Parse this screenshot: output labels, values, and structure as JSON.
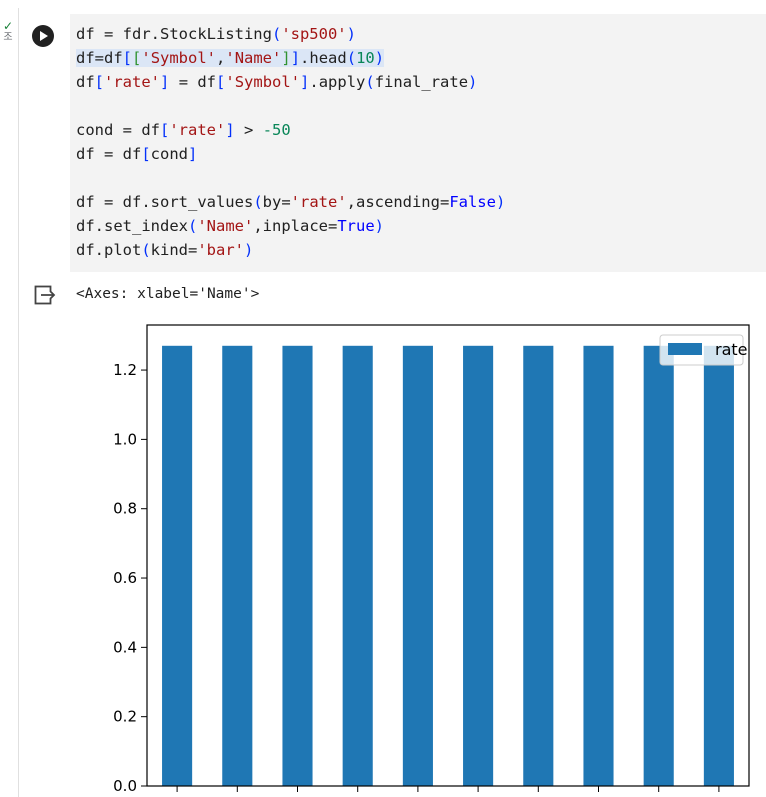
{
  "status": {
    "label": "조"
  },
  "code_lines": [
    "df = fdr.StockListing('sp500')",
    "df=df[['Symbol','Name']].head(10)",
    "df['rate'] = df['Symbol'].apply(final_rate)",
    "",
    "cond = df['rate'] > -50",
    "df = df[cond]",
    "",
    "df = df.sort_values(by='rate',ascending=False)",
    "df.set_index('Name',inplace=True)",
    "df.plot(kind='bar')"
  ],
  "output": {
    "text": "<Axes: xlabel='Name'>"
  },
  "chart_data": {
    "type": "bar",
    "categories": [
      "",
      "",
      "",
      "",
      "",
      "",
      "",
      "",
      "",
      ""
    ],
    "series": [
      {
        "name": "rate",
        "values": [
          1.27,
          1.27,
          1.27,
          1.27,
          1.27,
          1.27,
          1.27,
          1.27,
          1.27,
          1.27
        ]
      }
    ],
    "ylim": [
      0,
      1.33
    ],
    "yticks": [
      "0.0",
      "0.2",
      "0.4",
      "0.6",
      "0.8",
      "1.0",
      "1.2"
    ],
    "legend_position": "top-right",
    "bar_color": "#1f77b4",
    "grid": false
  }
}
